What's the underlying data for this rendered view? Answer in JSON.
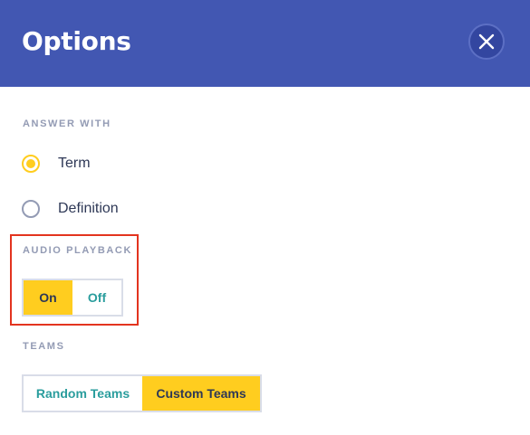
{
  "header": {
    "title": "Options",
    "close_icon": "close-icon",
    "background": "#4257b2"
  },
  "answer_with": {
    "label": "ANSWER WITH",
    "options": [
      {
        "label": "Term",
        "selected": true
      },
      {
        "label": "Definition",
        "selected": false
      }
    ]
  },
  "audio_playback": {
    "label": "AUDIO PLAYBACK",
    "options": [
      {
        "label": "On",
        "selected": true
      },
      {
        "label": "Off",
        "selected": false
      }
    ]
  },
  "teams": {
    "label": "TEAMS",
    "options": [
      {
        "label": "Random Teams",
        "selected": false
      },
      {
        "label": "Custom Teams",
        "selected": true
      }
    ]
  },
  "colors": {
    "accent_yellow": "#ffcd1f",
    "teal_text": "#2a9d9d",
    "highlight_red": "#e3341f"
  }
}
